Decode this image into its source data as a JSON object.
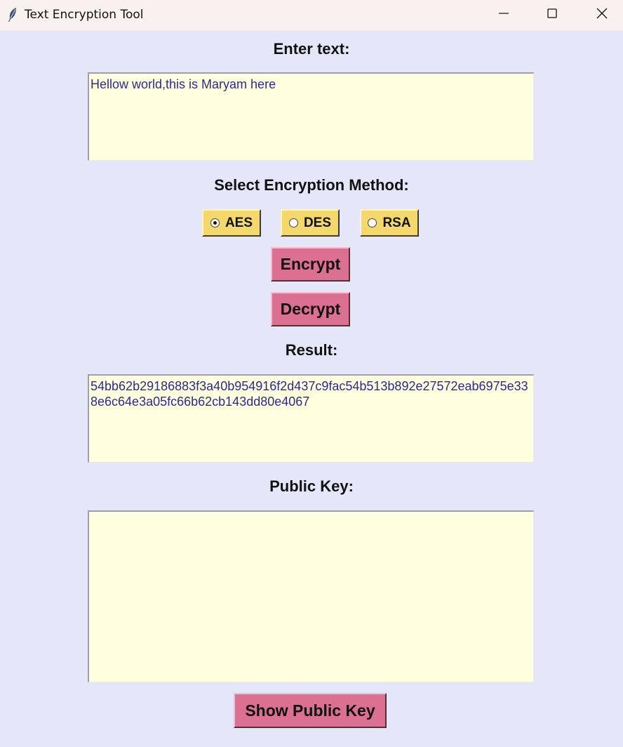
{
  "window": {
    "title": "Text Encryption Tool",
    "icon": "feather-icon"
  },
  "labels": {
    "enter_text": "Enter text:",
    "select_method": "Select Encryption Method:",
    "result": "Result:",
    "public_key": "Public Key:"
  },
  "input": {
    "value": "Hellow world,this is Maryam here"
  },
  "methods": [
    {
      "label": "AES",
      "selected": true
    },
    {
      "label": "DES",
      "selected": false
    },
    {
      "label": "RSA",
      "selected": false
    }
  ],
  "buttons": {
    "encrypt": "Encrypt",
    "decrypt": "Decrypt",
    "show_public_key": "Show Public Key"
  },
  "result": {
    "value": "54bb62b29186883f3a40b954916f2d437c9fac54b513b892e27572eab6975e338e6c64e3a05fc66b62cb143dd80e4067"
  },
  "public_key": {
    "value": ""
  },
  "colors": {
    "background": "#e6e6fa",
    "textbox": "#ffffe0",
    "radio": "#f4d86b",
    "button": "#db7093",
    "text": "#2b2b8a"
  }
}
